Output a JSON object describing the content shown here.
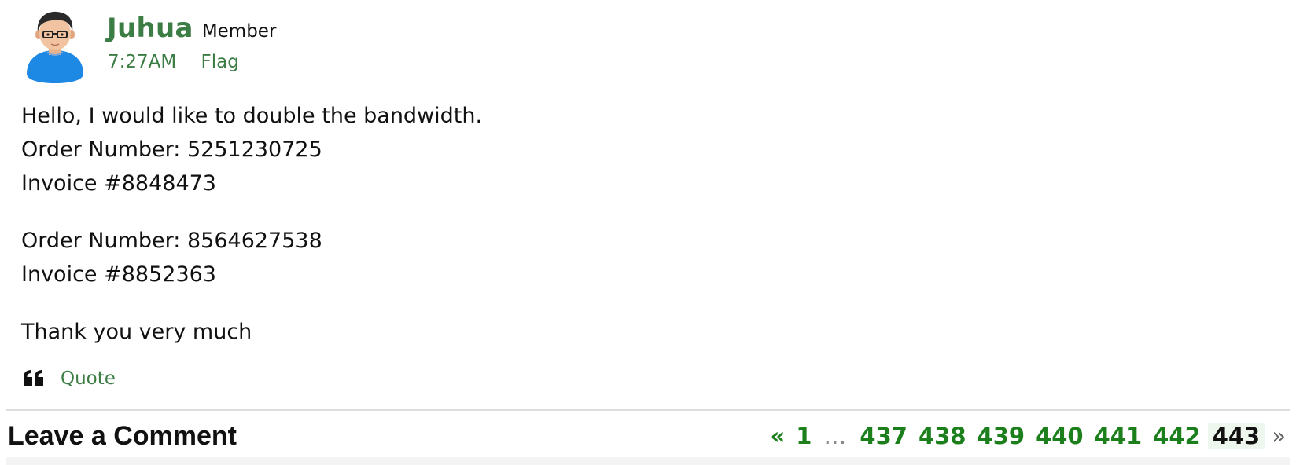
{
  "post": {
    "author": {
      "name": "Juhua",
      "role": "Member",
      "avatar_icon": "user-avatar-icon"
    },
    "meta": {
      "time": "7:27AM",
      "flag_label": "Flag"
    },
    "paragraphs": [
      [
        "Hello, I would like to double the bandwidth.",
        "Order Number: 5251230725",
        "Invoice #8848473"
      ],
      [
        "Order Number: 8564627538",
        "Invoice #8852363"
      ],
      [
        "Thank you very much"
      ]
    ],
    "actions": {
      "quote_icon": "quote-icon",
      "quote_label": "Quote"
    }
  },
  "footer": {
    "leave_comment_title": "Leave a Comment",
    "pagination": {
      "prev": "«",
      "first": "1",
      "ellipsis": "…",
      "pages": [
        "437",
        "438",
        "439",
        "440",
        "441",
        "442"
      ],
      "current": "443",
      "next": "»"
    }
  },
  "colors": {
    "link_green": "#3b7d44",
    "page_green": "#1b7f1b",
    "text": "#111111",
    "avatar_shirt": "#1e88e5"
  }
}
